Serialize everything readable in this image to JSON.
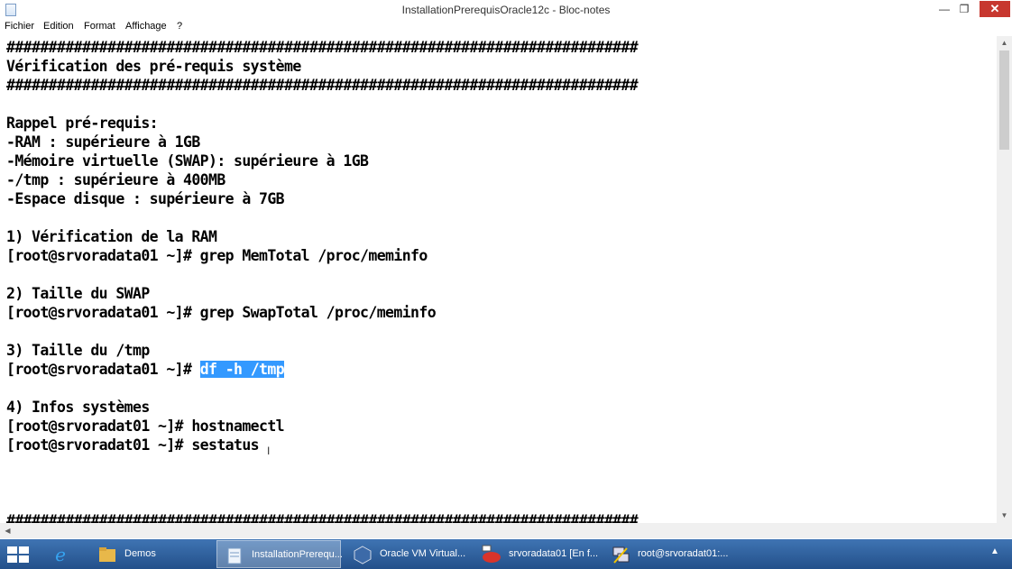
{
  "window": {
    "title": "InstallationPrerequisOracle12c - Bloc-notes",
    "minimize_glyph": "—",
    "maximize_glyph": "❐",
    "close_glyph": "✕"
  },
  "menu": [
    "Fichier",
    "Edition",
    "Format",
    "Affichage",
    "?"
  ],
  "editor": {
    "lines": [
      "###########################################################################",
      "Vérification des pré-requis système",
      "###########################################################################",
      "",
      "Rappel pré-requis:",
      "-RAM : supérieure à 1GB",
      "-Mémoire virtuelle (SWAP): supérieure à 1GB",
      "-/tmp : supérieure à 400MB",
      "-Espace disque : supérieure à 7GB",
      "",
      "1) Vérification de la RAM",
      "[root@srvoradata01 ~]# grep MemTotal /proc/meminfo",
      "",
      "2) Taille du SWAP",
      "[root@srvoradata01 ~]# grep SwapTotal /proc/meminfo",
      "",
      "3) Taille du /tmp",
      "[root@srvoradata01 ~]# df -h /tmp",
      "",
      "4) Infos systèmes",
      "[root@srvoradat01 ~]# hostnamectl",
      "[root@srvoradat01 ~]# sestatus",
      "",
      "",
      "",
      "###########################################################################"
    ],
    "selection": {
      "line": 17,
      "text": "df -h /tmp"
    }
  },
  "taskbar": {
    "items": [
      {
        "label": "",
        "icon": "ie-icon",
        "color": "#1e90ff"
      },
      {
        "label": "Demos",
        "icon": "folder-icon",
        "color": "#e8b84a"
      },
      {
        "label": "InstallationPrerequ...",
        "icon": "notepad-icon",
        "color": "#cfe0f3",
        "active": true
      },
      {
        "label": "Oracle VM Virtual...",
        "icon": "virtualbox-icon",
        "color": "#3c6aa8"
      },
      {
        "label": "srvoradata01 [En f...",
        "icon": "vm-redhat-icon",
        "color": "#d9342b"
      },
      {
        "label": "root@srvoradat01:...",
        "icon": "putty-icon",
        "color": "#8899cc"
      }
    ],
    "tray_glyph": "▲"
  }
}
